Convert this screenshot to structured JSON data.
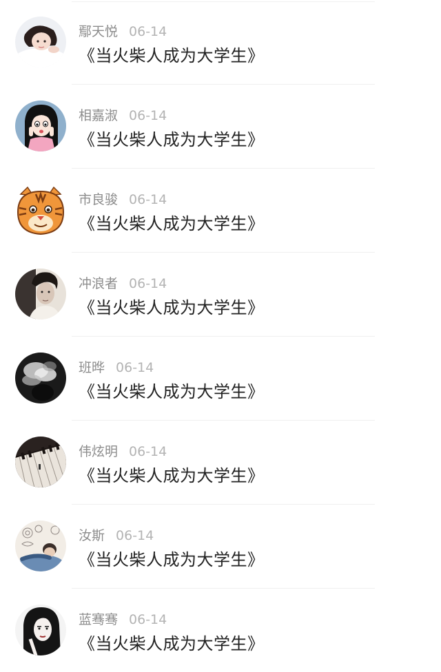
{
  "feed": {
    "items": [
      {
        "name": "鄢天悦",
        "date": "06-14",
        "title": "《当火柴人成为大学生》",
        "avatar_icon": "girl-photo-avatar"
      },
      {
        "name": "相嘉淑",
        "date": "06-14",
        "title": "《当火柴人成为大学生》",
        "avatar_icon": "cartoon-girl-avatar"
      },
      {
        "name": "市良骏",
        "date": "06-14",
        "title": "《当火柴人成为大学生》",
        "avatar_icon": "tiger-avatar"
      },
      {
        "name": "冲浪者",
        "date": "06-14",
        "title": "《当火柴人成为大学生》",
        "avatar_icon": "man-portrait-avatar"
      },
      {
        "name": "班晔",
        "date": "06-14",
        "title": "《当火柴人成为大学生》",
        "avatar_icon": "smoke-avatar"
      },
      {
        "name": "伟炫明",
        "date": "06-14",
        "title": "《当火柴人成为大学生》",
        "avatar_icon": "piano-avatar"
      },
      {
        "name": "汝斯",
        "date": "06-14",
        "title": "《当火柴人成为大学生》",
        "avatar_icon": "sleeping-boy-avatar"
      },
      {
        "name": "蓝骞骞",
        "date": "06-14",
        "title": "《当火柴人成为大学生》",
        "avatar_icon": "ink-girl-avatar"
      }
    ]
  },
  "colors": {
    "name_text": "#8c8c8c",
    "date_text": "#b3b3b3",
    "title_text": "#222222",
    "divider": "#f0f0f0",
    "tiger_orange": "#f0963a"
  }
}
